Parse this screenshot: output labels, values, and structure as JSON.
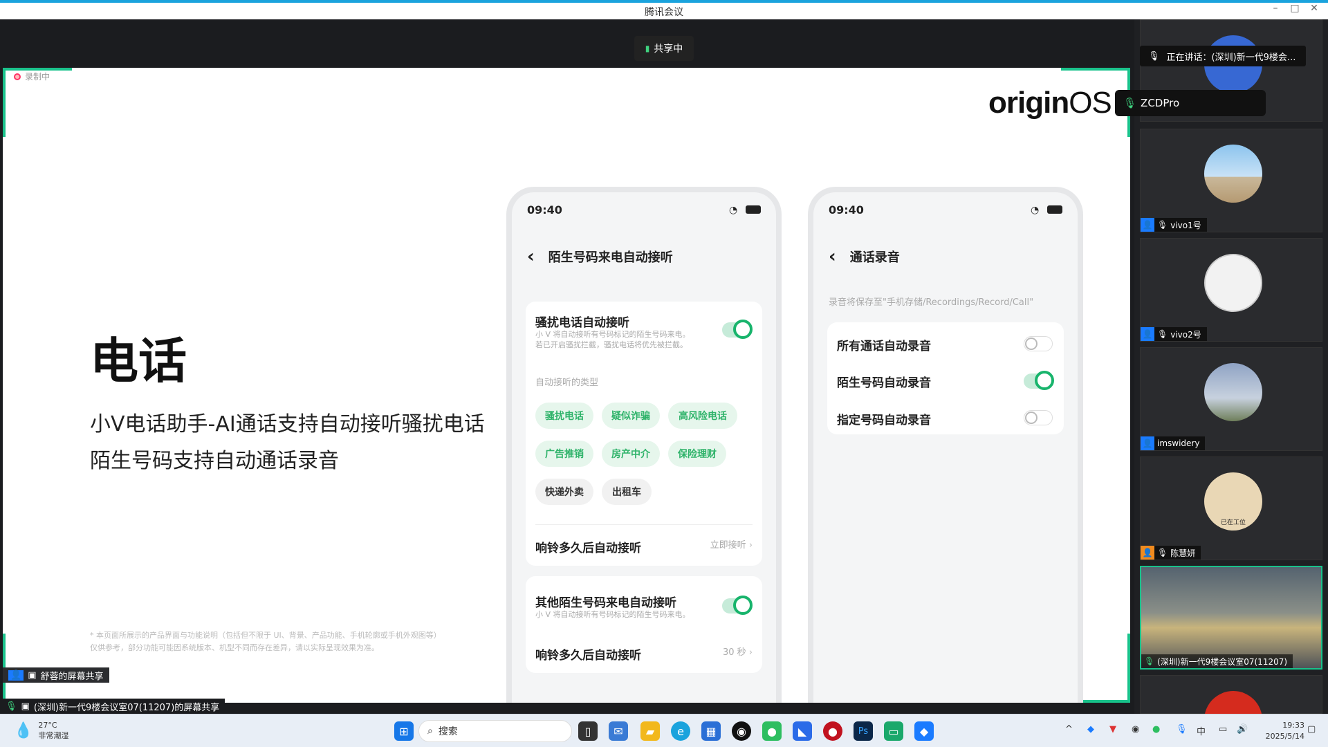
{
  "window": {
    "title": "腾讯会议",
    "minimize": "–",
    "maximize": "□",
    "close": "✕"
  },
  "share_status": "共享中",
  "recording": "录制中",
  "slide": {
    "logo_origin": "origin",
    "logo_os": "OS",
    "title": "电话",
    "subtitle1": "小V电话助手-AI通话支持自动接听骚扰电话",
    "subtitle2": "陌生号码支持自动通话录音",
    "fine1": "* 本页面所展示的产品界面与功能说明（包括但不限于 UI、背景、产品功能、手机轮廓或手机外观图等）",
    "fine2": "仅供参考，部分功能可能因系统版本、机型不同而存在差异，请以实际呈现效果为准。"
  },
  "phone1": {
    "time": "09:40",
    "nav_back": "‹",
    "title": "陌生号码来电自动接听",
    "row1_label": "骚扰电话自动接听",
    "row1_sub1": "小 V 将自动接听有号码标记的陌生号码来电。",
    "row1_sub2": "若已开启骚扰拦截，骚扰电话将优先被拦截。",
    "types_label": "自动接听的类型",
    "chips": [
      "骚扰电话",
      "疑似诈骗",
      "高风险电话",
      "广告推销",
      "房产中介",
      "保险理财",
      "快递外卖",
      "出租车"
    ],
    "ring_label": "响铃多久后自动接听",
    "ring_value": "立即接听",
    "row2_label": "其他陌生号码来电自动接听",
    "row2_sub": "小 V 将自动接听有号码标记的陌生号码来电。",
    "ring2_label": "响铃多久后自动接听",
    "ring2_value": "30 秒"
  },
  "phone2": {
    "time": "09:40",
    "nav_back": "‹",
    "title": "通话录音",
    "note": "录音将保存至\"手机存储/Recordings/Record/Call\"",
    "rows": [
      "所有通话自动录音",
      "陌生号码自动录音",
      "指定号码自动录音"
    ]
  },
  "panel": {
    "speaking": "正在讲话：(深圳)新一代9楼会...",
    "tooltip": "ZCDPro",
    "participants": [
      "vivo1号",
      "vivo2号",
      "imswidery",
      "陈慧妍",
      "(深圳)新一代9楼会议室07(11207)"
    ],
    "avatar_text_5": "已在工位"
  },
  "captions": {
    "shurong": "舒蓉的屏幕共享",
    "room": "(深圳)新一代9楼会议室07(11207)的屏幕共享"
  },
  "taskbar": {
    "temp": "27°C",
    "weather": "非常潮湿",
    "search": "搜索",
    "ime": "中",
    "time": "19:33",
    "date": "2025/5/14"
  },
  "colors": {
    "accent": "#18b46c",
    "brand": "#1aa3dd"
  }
}
